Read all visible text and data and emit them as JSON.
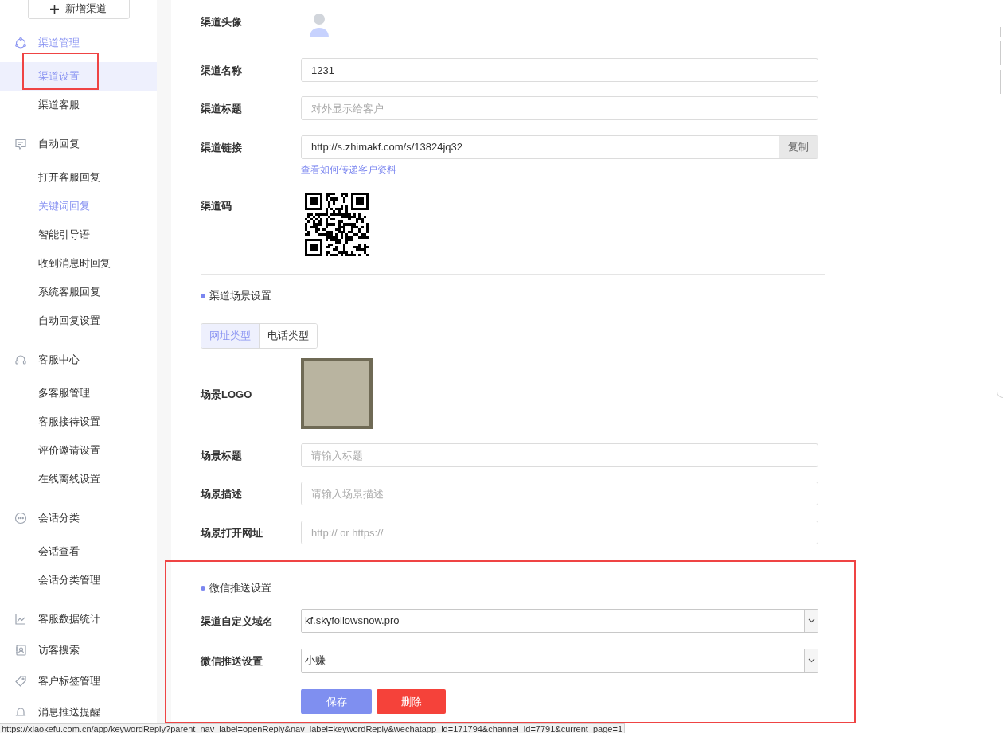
{
  "sidebar": {
    "new_button": "新增渠道",
    "groups": [
      {
        "title": "渠道管理",
        "active": true,
        "items": [
          {
            "label": "渠道设置",
            "selected": true,
            "current": true,
            "highlighted": true
          },
          {
            "label": "渠道客服",
            "selected": false,
            "current": false,
            "highlighted": false
          }
        ]
      },
      {
        "title": "自动回复",
        "active": false,
        "items": [
          {
            "label": "打开客服回复",
            "selected": false,
            "current": false,
            "highlighted": false
          },
          {
            "label": "关键词回复",
            "selected": false,
            "current": true,
            "highlighted": false
          },
          {
            "label": "智能引导语",
            "selected": false,
            "current": false,
            "highlighted": false
          },
          {
            "label": "收到消息时回复",
            "selected": false,
            "current": false,
            "highlighted": false
          },
          {
            "label": "系统客服回复",
            "selected": false,
            "current": false,
            "highlighted": false
          },
          {
            "label": "自动回复设置",
            "selected": false,
            "current": false,
            "highlighted": false
          }
        ]
      },
      {
        "title": "客服中心",
        "active": false,
        "items": [
          {
            "label": "多客服管理",
            "selected": false,
            "current": false,
            "highlighted": false
          },
          {
            "label": "客服接待设置",
            "selected": false,
            "current": false,
            "highlighted": false
          },
          {
            "label": "评价邀请设置",
            "selected": false,
            "current": false,
            "highlighted": false
          },
          {
            "label": "在线离线设置",
            "selected": false,
            "current": false,
            "highlighted": false
          }
        ]
      },
      {
        "title": "会话分类",
        "active": false,
        "items": [
          {
            "label": "会话查看",
            "selected": false,
            "current": false,
            "highlighted": false
          },
          {
            "label": "会话分类管理",
            "selected": false,
            "current": false,
            "highlighted": false
          }
        ]
      },
      {
        "title": "客服数据统计",
        "active": false
      },
      {
        "title": "访客搜索",
        "active": false
      },
      {
        "title": "客户标签管理",
        "active": false
      },
      {
        "title": "消息推送提醒",
        "active": false
      }
    ]
  },
  "channel": {
    "avatar_label": "渠道头像",
    "name_label": "渠道名称",
    "name_value": "1231",
    "title_label": "渠道标题",
    "title_placeholder": "对外显示给客户",
    "link_label": "渠道链接",
    "link_value": "http://s.zhimakf.com/s/13824jq32",
    "copy_button": "复制",
    "help_link": "查看如何传递客户资料",
    "code_label": "渠道码"
  },
  "scene": {
    "heading": "渠道场景设置",
    "tabs": [
      {
        "label": "网址类型",
        "selected": true
      },
      {
        "label": "电话类型",
        "selected": false
      }
    ],
    "logo_label": "场景LOGO",
    "title_label": "场景标题",
    "title_placeholder": "请输入标题",
    "desc_label": "场景描述",
    "desc_placeholder": "请输入场景描述",
    "url_label": "场景打开网址",
    "url_placeholder": "http:// or https://"
  },
  "wechat": {
    "highlighted": true,
    "heading": "微信推送设置",
    "domain_label": "渠道自定义域名",
    "domain_value": "kf.skyfollowsnow.pro",
    "push_label": "微信推送设置",
    "push_value": "小赚",
    "save_button": "保存",
    "delete_button": "删除"
  },
  "status_bar": "https://xiaokefu.com.cn/app/keywordReply?parent_nav_label=openReply&nav_label=keywordReply&wechatapp_id=171794&channel_id=7791&current_page=1"
}
